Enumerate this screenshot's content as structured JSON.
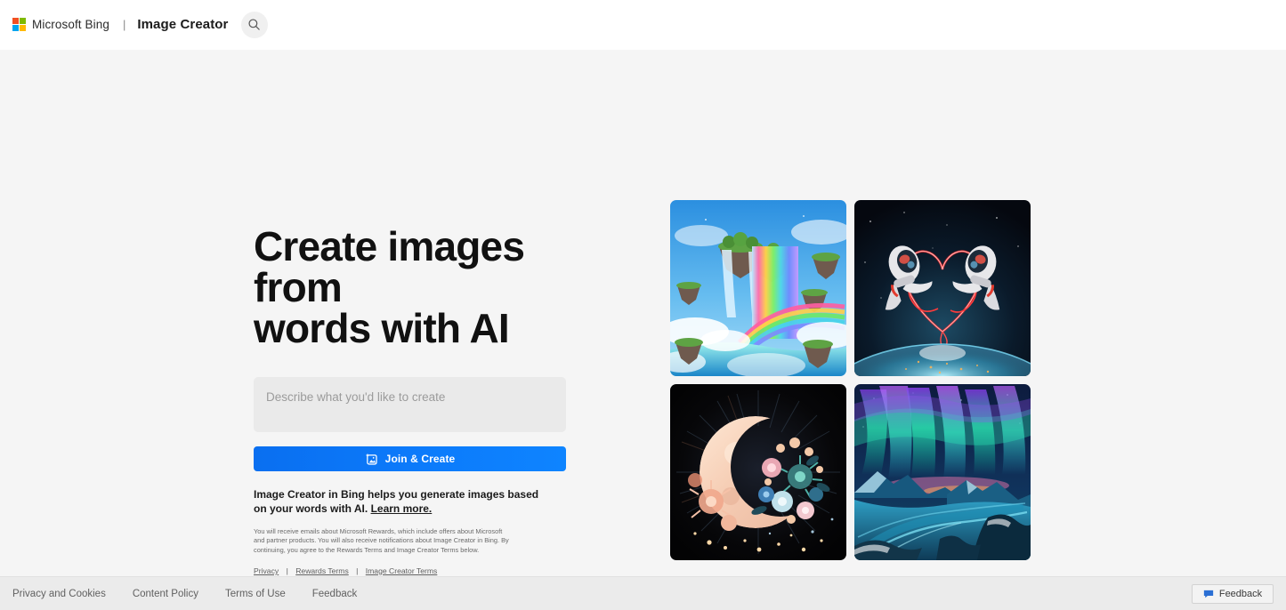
{
  "header": {
    "brand": "Microsoft Bing",
    "separator": "|",
    "app_title": "Image Creator",
    "search_icon": "search-icon",
    "logo_colors": {
      "red": "#f25022",
      "green": "#7fba00",
      "blue": "#00a4ef",
      "yellow": "#ffb900"
    }
  },
  "hero": {
    "headline_line1": "Create images from",
    "headline_line2": "words with AI",
    "prompt_placeholder": "Describe what you'd like to create",
    "prompt_value": "",
    "cta_label": "Join & Create",
    "cta_icon": "image-sparkle-icon",
    "cta_color": "#0b78fa",
    "blurb_text": "Image Creator in Bing helps you generate images based on your words with AI. ",
    "blurb_link": "Learn more.",
    "fine_print": "You will receive emails about Microsoft Rewards, which include offers about Microsoft and partner products. You will also receive notifications about Image Creator in Bing. By continuing, you agree to the Rewards Terms and Image Creator Terms below.",
    "legal_links": [
      "Privacy",
      "Rewards Terms",
      "Image Creator Terms"
    ],
    "legal_separator": "|"
  },
  "gallery": {
    "tiles": [
      {
        "name": "rainbow-waterfall",
        "alt": "Rainbow waterfall falling from floating islands into a lagoon with a rainbow arc"
      },
      {
        "name": "astronauts-neon-heart",
        "alt": "Two astronauts drawing a glowing red neon heart above Earth"
      },
      {
        "name": "floral-crescent-moon",
        "alt": "Crescent moon covered in flowers on a dark starburst background"
      },
      {
        "name": "aurora-landscape",
        "alt": "Aurora borealis over a snowy glacial landscape"
      }
    ]
  },
  "footer": {
    "links": [
      "Privacy and Cookies",
      "Content Policy",
      "Terms of Use",
      "Feedback"
    ],
    "feedback_label": "Feedback",
    "feedback_icon": "speech-bubble-icon"
  }
}
